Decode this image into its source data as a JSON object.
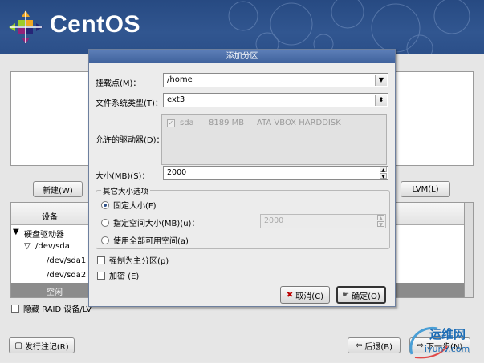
{
  "banner": {
    "logo_text": "CentOS",
    "logo_icon": "centos-logo-icon"
  },
  "installer": {
    "new_button": "新建(W)",
    "lvm_button": "LVM(L)",
    "table_header_device": "设备",
    "tree": [
      {
        "label": "硬盘驱动器",
        "indent": 0,
        "expander": "▼"
      },
      {
        "label": "/dev/sda",
        "indent": 1,
        "expander": "▽"
      },
      {
        "label": "/dev/sda1",
        "indent": 2,
        "expander": ""
      },
      {
        "label": "/dev/sda2",
        "indent": 2,
        "expander": ""
      },
      {
        "label": "空闲",
        "indent": 2,
        "expander": "",
        "selected": true
      }
    ],
    "hide_raid_label": "隐藏 RAID 设备/LV",
    "release_notes_button": "发行注记(R)",
    "back_button": "后退(B)",
    "next_button": "下一步(N)"
  },
  "dialog": {
    "title": "添加分区",
    "mount_point_label": "挂载点(M)：",
    "mount_point_value": "/home",
    "fs_type_label": "文件系统类型(T)：",
    "fs_type_value": "ext3",
    "drives_label": "允许的驱动器(D)：",
    "drive": {
      "name": "sda",
      "size": "8189 MB",
      "model": "ATA VBOX HARDDISK",
      "checked": true
    },
    "size_label": "大小(MB)(S)：",
    "size_value": "2000",
    "other_options_title": "其它大小选项",
    "opt_fixed": "固定大小(F)",
    "opt_fill_up_to": "指定空间大小(MB)(u)：",
    "opt_fill_up_to_value": "2000",
    "opt_fill_all": "使用全部可用空间(a)",
    "force_primary_label": "强制为主分区(p)",
    "encrypt_label": "加密 (E)",
    "cancel_button": "取消(C)",
    "ok_button": "确定(O)"
  },
  "watermark": {
    "line1": "运维网",
    "line2": "iyunv.com"
  }
}
